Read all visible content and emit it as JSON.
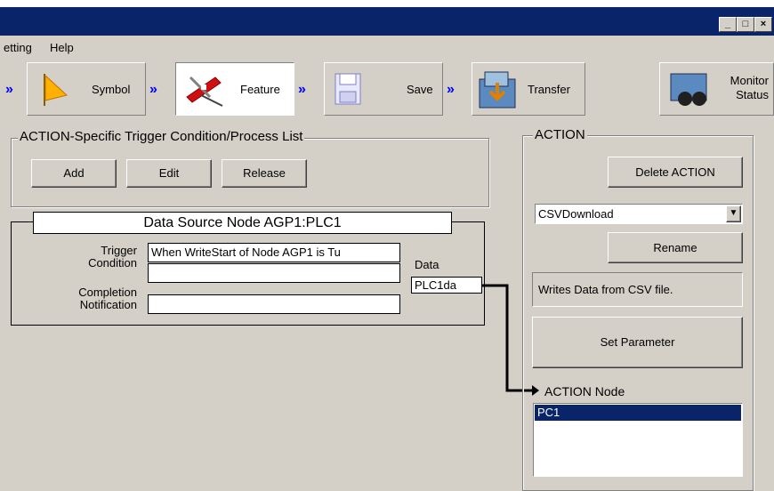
{
  "menu": {
    "setting": "etting",
    "help": "Help"
  },
  "toolbar": {
    "symbol": "Symbol",
    "feature": "Feature",
    "save": "Save",
    "transfer": "Transfer",
    "monitor_line1": "Monitor",
    "monitor_line2": "Status",
    "arrow_glyph": "»"
  },
  "window_buttons": {
    "minimize": "_",
    "maximize": "□",
    "close": "×"
  },
  "trigger_group": {
    "title": "ACTION-Specific Trigger Condition/Process List",
    "add": "Add",
    "edit": "Edit",
    "release": "Release"
  },
  "node": {
    "title": "Data Source Node AGP1:PLC1",
    "trigger_label_1": "Trigger",
    "trigger_label_2": "Condition",
    "trigger_value": "When WriteStart of Node AGP1 is Tu",
    "completion_label_1": "Completion",
    "completion_label_2": "Notification",
    "data_label": "Data",
    "data_value": "PLC1da"
  },
  "action": {
    "title": "ACTION",
    "delete": "Delete ACTION",
    "selected": "CSVDownload",
    "rename": "Rename",
    "description": "Writes Data from CSV file.",
    "set_parameter": "Set Parameter",
    "node_label": "ACTION Node",
    "node_items": [
      "PC1"
    ]
  },
  "colors": {
    "caption": "#0a246a",
    "selection": "#0a246a",
    "arrow": "#0000ff",
    "face": "#d4d0c8"
  }
}
